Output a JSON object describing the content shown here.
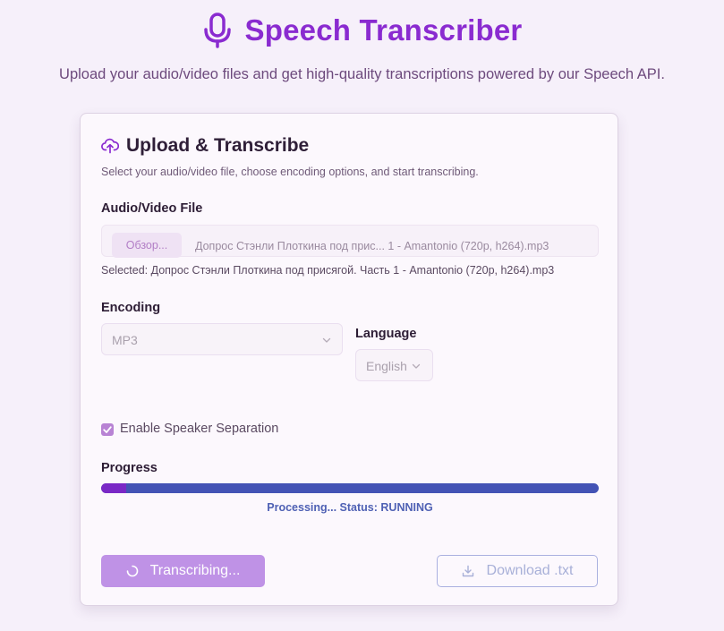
{
  "header": {
    "title": "Speech Transcriber",
    "subtitle": "Upload your audio/video files and get high-quality transcriptions powered by our Speech API."
  },
  "card": {
    "title": "Upload & Transcribe",
    "description": "Select your audio/video file, choose encoding options, and start transcribing.",
    "file": {
      "label": "Audio/Video File",
      "browse_label": "Обзор...",
      "file_name": "Допрос Стэнли Плоткина под прис... 1 - Amantonio (720p, h264).mp3",
      "selected_text": "Selected: Допрос Стэнли Плоткина под присягой. Часть 1 - Amantonio (720p, h264).mp3"
    },
    "encoding": {
      "label": "Encoding",
      "value": "MP3"
    },
    "language": {
      "label": "Language",
      "value": "English"
    },
    "speaker_separation": {
      "label": "Enable Speaker Separation",
      "checked": true
    },
    "progress": {
      "label": "Progress",
      "value": 0.05,
      "status": "Processing... Status: RUNNING"
    },
    "actions": {
      "transcribe_label": "Transcribing...",
      "download_label": "Download .txt"
    }
  },
  "colors": {
    "accent": "#8a2bd0",
    "progress_fill": "#7a28c6",
    "progress_track": "#4353b5",
    "button_primary": "#bf92e6"
  }
}
